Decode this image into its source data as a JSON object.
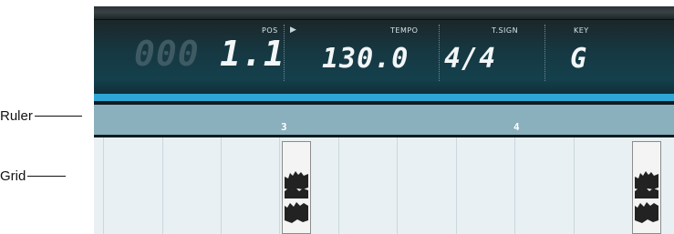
{
  "callouts": {
    "ruler": "Ruler",
    "grid": "Grid"
  },
  "transport": {
    "pos_ghost": "000",
    "pos_value": "1.1",
    "pos_caption": "POS",
    "play_glyph": "▶",
    "tempo_caption": "TEMPO",
    "tempo_value": "130.0",
    "tsign_caption": "T.SIGN",
    "tsign_value": "4/4",
    "key_caption": "KEY",
    "key_value": "G"
  },
  "ruler": {
    "bars": [
      "3",
      "4"
    ]
  },
  "grid": {
    "clip_count": 2
  },
  "colors": {
    "accent_band": "#2ea6d6",
    "ruler": "#8aafbd",
    "grid_bg": "#e8f0f3",
    "lcd_text": "#f2f6f7"
  }
}
